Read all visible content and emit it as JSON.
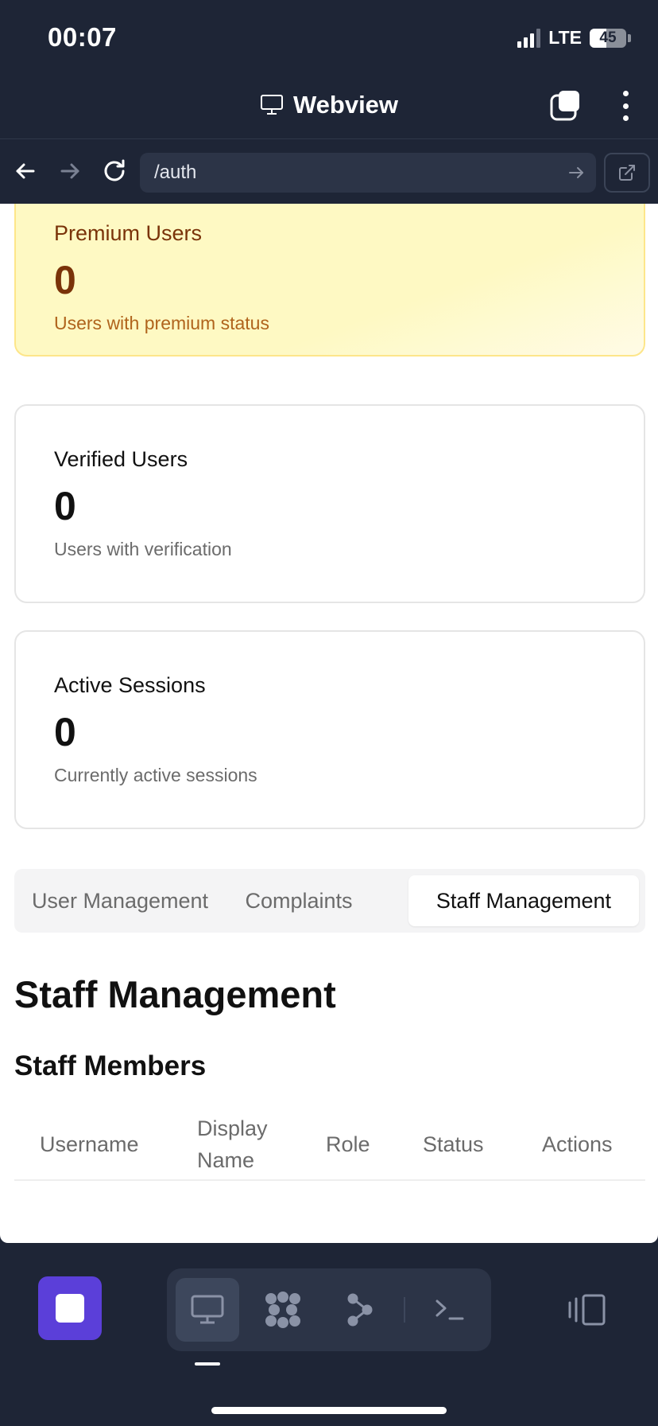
{
  "status_bar": {
    "time": "00:07",
    "network": "LTE",
    "battery_level": "45",
    "battery_fraction": 0.45
  },
  "title_bar": {
    "title": "Webview",
    "title_icon": "monitor-icon",
    "tabs_icon": "tabs-icon",
    "menu_icon": "more-vertical-icon"
  },
  "url_bar": {
    "back_icon": "arrow-left-icon",
    "forward_icon": "arrow-right-icon",
    "reload_icon": "reload-icon",
    "url": "/auth",
    "go_icon": "arrow-right-icon",
    "open_external_icon": "external-link-icon"
  },
  "stats": {
    "premium": {
      "title": "Premium Users",
      "value": "0",
      "subtitle": "Users with premium status"
    },
    "verified": {
      "title": "Verified Users",
      "value": "0",
      "subtitle": "Users with verification"
    },
    "sessions": {
      "title": "Active Sessions",
      "value": "0",
      "subtitle": "Currently active sessions"
    }
  },
  "tabs": [
    {
      "label": "User Management",
      "active": false
    },
    {
      "label": "Complaints",
      "active": false
    },
    {
      "label": "Staff Management",
      "active": true
    }
  ],
  "section": {
    "title": "Staff Management",
    "subtitle": "Staff Members"
  },
  "table": {
    "columns": [
      "Username",
      "Display Name",
      "Role",
      "Status",
      "Actions"
    ],
    "rows": []
  },
  "dock": {
    "app_icon": "stop-square-icon",
    "tools": [
      "monitor-icon",
      "cluster-icon",
      "graph-icon",
      "terminal-icon"
    ],
    "active_tool": "monitor-icon",
    "side_icon": "panel-toggle-icon"
  },
  "colors": {
    "chrome_bg": "#1e2536",
    "accent_purple": "#5b3fd9",
    "premium_bg": "#fef9c3",
    "premium_text": "#7a3309"
  }
}
